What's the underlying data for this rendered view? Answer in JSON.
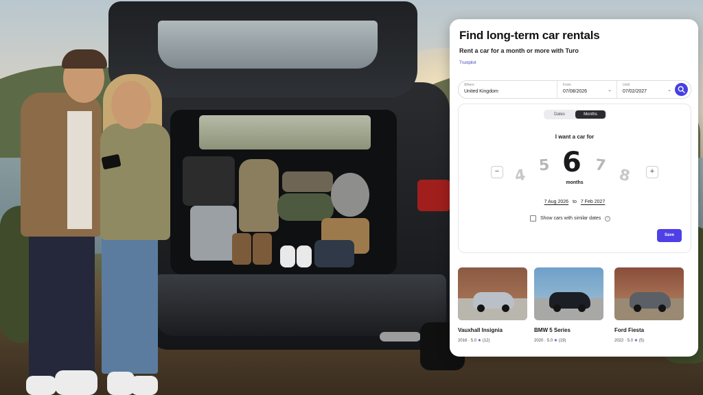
{
  "hero": {
    "title": "Find long-term car rentals",
    "subtitle": "Rent a car for a month or more with Turo",
    "trust_label": "Trustpilot"
  },
  "search": {
    "where": {
      "label": "Where",
      "value": "United Kingdom"
    },
    "from": {
      "label": "From",
      "value": "07/08/2026"
    },
    "until": {
      "label": "Until",
      "value": "07/02/2027"
    },
    "search_icon": "search-icon",
    "accent": "#4740e0"
  },
  "duration_panel": {
    "tabs": [
      "Dates",
      "Months"
    ],
    "active_tab": "Months",
    "prompt": "I want a car for",
    "dial": [
      "4",
      "5",
      "6",
      "7",
      "8"
    ],
    "selected": "6",
    "unit": "months",
    "start_date": "7 Aug 2026",
    "separator": "to",
    "end_date": "7 Feb 2027",
    "similar_label": "Show cars with similar dates",
    "similar_checked": false,
    "save_label": "Save",
    "minus_symbol": "−",
    "plus_symbol": "+"
  },
  "cars": [
    {
      "name": "Vauxhall Insignia",
      "year": "2016",
      "rating": "5.0",
      "star": "★",
      "reviews": "(12)",
      "color": "#b9c0c7"
    },
    {
      "name": "BMW 5 Series",
      "year": "2020",
      "rating": "5.0",
      "star": "★",
      "reviews": "(19)",
      "color": "#1b1e25"
    },
    {
      "name": "Ford Fiesta",
      "year": "2022",
      "rating": "5.0",
      "star": "★",
      "reviews": "(5)",
      "color": "#5b5f66"
    }
  ]
}
